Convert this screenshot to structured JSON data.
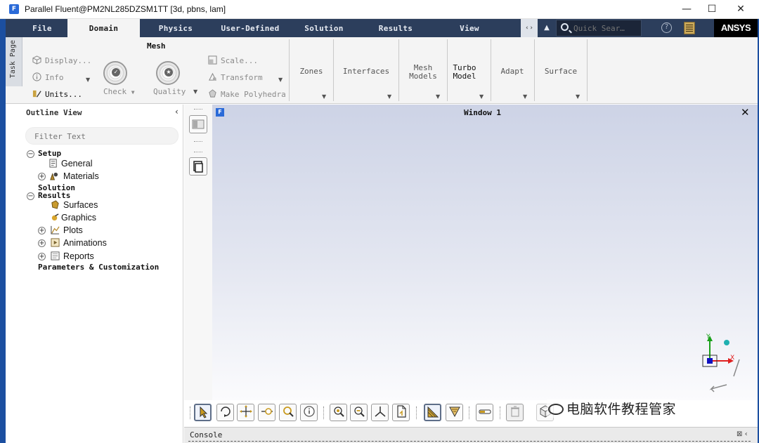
{
  "window": {
    "title": "Parallel Fluent@PM2NL285DZSM1TT  [3d, pbns, lam]",
    "app_icon": "F",
    "minimize": "—",
    "maximize": "☐",
    "close": "✕"
  },
  "ribbon_tabs": [
    {
      "label": "File"
    },
    {
      "label": "Domain"
    },
    {
      "label": "Physics"
    },
    {
      "label": "User-Defined"
    },
    {
      "label": "Solution"
    },
    {
      "label": "Results"
    },
    {
      "label": "View"
    }
  ],
  "tab_arrows": "‹ ›",
  "quick_search": {
    "placeholder": "Quick Sear…"
  },
  "help": "?",
  "brand": "ANSYS",
  "task_page": "Task Page",
  "ribbon": {
    "mesh_group_title": "Mesh",
    "display": "Display...",
    "info": "Info",
    "units": "Units...",
    "check": "Check",
    "quality": "Quality",
    "scale": "Scale...",
    "transform": "Transform",
    "make_polyhedra": "Make Polyhedra",
    "zones": "Zones",
    "interfaces": "Interfaces",
    "mesh_models": "Mesh\nModels",
    "mesh_models_l1": "Mesh",
    "mesh_models_l2": "Models",
    "turbo_model_l1": "Turbo",
    "turbo_model_l2": "Model",
    "adapt": "Adapt",
    "surface": "Surface"
  },
  "outline": {
    "title": "Outline View",
    "filter_placeholder": "Filter Text",
    "nodes": {
      "setup": "Setup",
      "general": "General",
      "materials": "Materials",
      "solution": "Solution",
      "results": "Results",
      "surfaces": "Surfaces",
      "graphics": "Graphics",
      "plots": "Plots",
      "animations": "Animations",
      "reports": "Reports",
      "parameters": "Parameters & Customization"
    }
  },
  "graphics": {
    "icon": "F",
    "title": "Window 1",
    "close": "✕"
  },
  "triad": {
    "y": "Y",
    "x": "X"
  },
  "watermark": "电脑软件教程管家",
  "console": {
    "label": "Console"
  },
  "colors": {
    "frame": "#1c4fa0",
    "tab_bar": "#2c3e5c",
    "ribbon_bg": "#f4f4f4",
    "axis_x": "#e02020",
    "axis_y": "#18a018",
    "axis_z": "#1010c0"
  }
}
